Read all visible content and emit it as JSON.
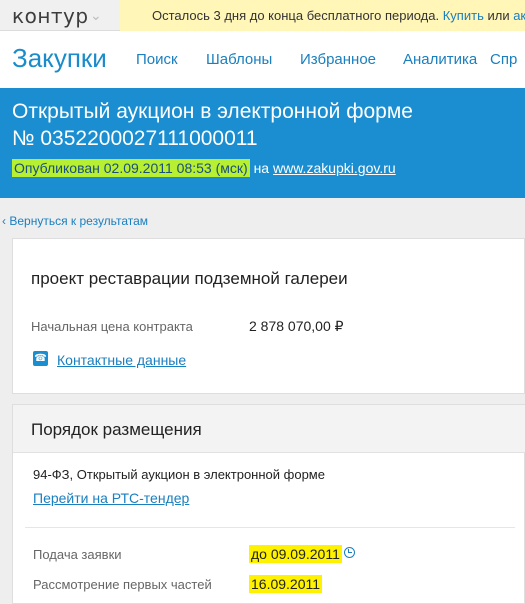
{
  "topbar": {
    "logo_text": "контур",
    "trial_text": "Осталось 3 дня до конца бесплатного периода.",
    "buy_link": "Купить",
    "or_text": "или",
    "rest_link": "ак"
  },
  "nav": {
    "brand": "Закупки",
    "items": [
      "Поиск",
      "Шаблоны",
      "Избранное",
      "Аналитика",
      "Спр"
    ]
  },
  "hero": {
    "title_line1": "Открытый аукцион в электронной форме",
    "title_line2": "№ 0352200027111000011",
    "published_label": "Опубликован 02.09.2011 08:53 (мск)",
    "on_text": "на",
    "site_link": "www.zakupki.gov.ru"
  },
  "back_link": "Вернуться к результатам",
  "summary": {
    "title": "проект реставрации подземной галереи",
    "price_label": "Начальная цена контракта",
    "price_value": "2 878 070,00 ₽",
    "contacts_link": "Контактные данные"
  },
  "placement": {
    "title": "Порядок размещения",
    "law_text": "94-ФЗ, Открытый аукцион в электронной форме",
    "rts_link": "Перейти на РТС-тендер",
    "rows": [
      {
        "label": "Подача заявки",
        "value": "до 09.09.2011"
      },
      {
        "label": "Рассмотрение первых частей",
        "value": "16.09.2011"
      }
    ]
  },
  "colors": {
    "accent": "#1a8ed0",
    "link": "#1a7fbf",
    "trial_bg": "#fff6b8",
    "highlight_green": "#b7f032",
    "highlight_yellow": "#fff200"
  },
  "icons": [
    "chevron-down-icon",
    "phone-icon",
    "clock-icon",
    "back-arrow-icon"
  ]
}
